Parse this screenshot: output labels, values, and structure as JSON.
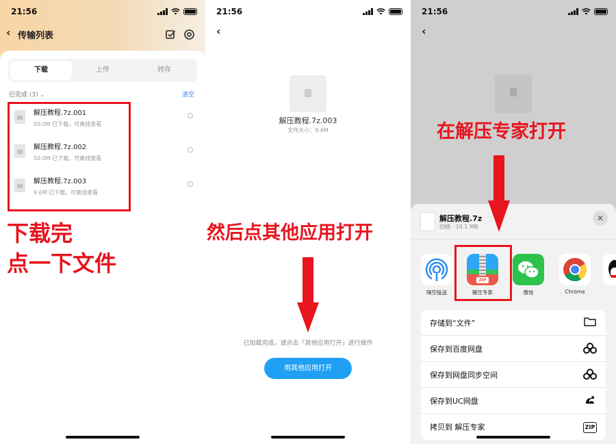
{
  "status": {
    "time": "21:56"
  },
  "panel1": {
    "title": "传输列表",
    "tabs": [
      "下载",
      "上传",
      "转存"
    ],
    "section_label": "已完成 (3)",
    "clear_label": "清空",
    "files": [
      {
        "name": "解压教程.7z.001",
        "meta": "50.0M  已下载，可离线查看"
      },
      {
        "name": "解压教程.7z.002",
        "meta": "50.0M  已下载，可离线查看"
      },
      {
        "name": "解压教程.7z.003",
        "meta": "9.6M  已下载，可离线查看"
      }
    ],
    "annotation_line1": "下载完",
    "annotation_line2": "点一下文件"
  },
  "panel2": {
    "file_name": "解压教程.7z.003",
    "file_size": "文件大小：9.6M",
    "annotation": "然后点其他应用打开",
    "hint": "已加载完成，请点击「其他应用打开」进行操作",
    "button_label": "用其他应用打开"
  },
  "panel3": {
    "annotation": "在解压专家打开",
    "sheet_title": "解压教程.7z",
    "sheet_subtitle": "归档 · 10.1 MB",
    "apps": [
      "隔空投送",
      "解压专家",
      "微信",
      "Chrome"
    ],
    "zip_badge": "ZIP",
    "actions": [
      {
        "label": "存储到“文件”",
        "icon": "folder-icon"
      },
      {
        "label": "保存到百度网盘",
        "icon": "baidu-netdisk-icon"
      },
      {
        "label": "保存到网盘同步空间",
        "icon": "sync-space-icon"
      },
      {
        "label": "保存到UC网盘",
        "icon": "uc-icon"
      },
      {
        "label": "拷贝到 解压专家",
        "icon": "zip-icon"
      }
    ],
    "zip_action_badge": "ZIP"
  },
  "colors": {
    "annotation_red": "#e8141e",
    "button_blue": "#1fa0f2",
    "link_blue": "#2f8bf0"
  }
}
